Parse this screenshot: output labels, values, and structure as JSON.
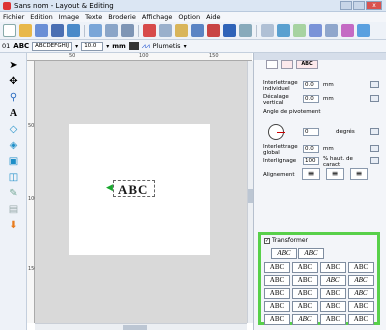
{
  "window": {
    "title": "Sans nom - Layout & Editing",
    "close_label": "x"
  },
  "menu": [
    "Fichier",
    "Edition",
    "Image",
    "Texte",
    "Broderie",
    "Affichage",
    "Option",
    "Aide"
  ],
  "fontbar": {
    "font_number": "01",
    "font_sample": "ABC",
    "font_name": "ABCDEFGHIJ",
    "size": "10.0",
    "unit": "mm",
    "stitch_label": "Plumetis"
  },
  "ruler": {
    "top": [
      "50",
      "100",
      "150"
    ],
    "left": [
      "50",
      "100",
      "150"
    ]
  },
  "canvas": {
    "text": "ABC"
  },
  "panel": {
    "tabs": [
      "",
      "",
      "ABC"
    ],
    "interletter_label": "Interlettrage individuel",
    "interletter_value": "0.0",
    "offset_label": "Décalage vertical",
    "offset_value": "0.0",
    "unit": "mm",
    "angle_label": "Angle de pivotement",
    "angle_value": "0",
    "angle_unit": "degrés",
    "global_label": "Interlettrage global",
    "global_value": "0.0",
    "spacing_label": "Interlignage",
    "spacing_value": "100",
    "spacing_unit": "% haut. de caract",
    "alignment_label": "Alignement",
    "align_icons": [
      "≡",
      "≡",
      "≡"
    ]
  },
  "transform": {
    "checkbox_mark": "✓",
    "label": "Transformer",
    "options": [
      [
        "ABC",
        "ABC"
      ],
      [
        "ABC",
        "ABC",
        "ABC",
        "ABC"
      ],
      [
        "ABC",
        "ABC",
        "ABC",
        "ABC"
      ],
      [
        "ABC",
        "ABC",
        "ABC",
        "ABC"
      ],
      [
        "ABC",
        "ABC",
        "ABC",
        "ABC"
      ],
      [
        "ABC",
        "ABC",
        "ABC",
        "ABC"
      ],
      [
        "ABC",
        "ABC",
        "ABC",
        "ABC"
      ]
    ]
  },
  "colors": {
    "accent_green": "#58d04a",
    "titlebar": "#dbe6f3"
  }
}
